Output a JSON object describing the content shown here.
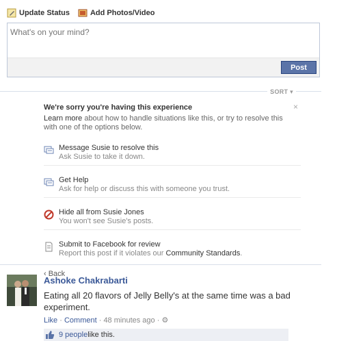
{
  "composer": {
    "tabs": [
      {
        "label": "Update Status",
        "icon": "status-pencil-icon"
      },
      {
        "label": "Add Photos/Video",
        "icon": "photo-icon"
      }
    ],
    "placeholder": "What's on your mind?",
    "post_label": "Post"
  },
  "feed": {
    "sort_label": "SORT"
  },
  "feedback": {
    "title": "We're sorry you're having this experience",
    "close_glyph": "×",
    "desc_link": "Learn more",
    "desc_text": " about how to handle situations like this, or try to resolve this with one of the options below.",
    "options": [
      {
        "label": "Message Susie to resolve this",
        "sub": "Ask Susie to take it down.",
        "icon": "message-icon"
      },
      {
        "label": "Get Help",
        "sub": "Ask for help or discuss this with someone you trust.",
        "icon": "help-chat-icon"
      },
      {
        "label": "Hide all from Susie Jones",
        "sub": "You won't see Susie's posts.",
        "icon": "block-icon"
      },
      {
        "label": "Submit to Facebook for review",
        "sub": "Report this post if it violates our ",
        "sub_link": "Community Standards",
        "sub_end": ".",
        "icon": "report-document-icon"
      }
    ],
    "back_label": "‹ Back"
  },
  "story": {
    "author": "Ashoke Chakrabarti",
    "message": "Eating all 20 flavors of Jelly Belly's at the same time was a bad experiment.",
    "like_label": "Like",
    "separator": " · ",
    "comment_label": "Comment",
    "timestamp": "48 minutes ago",
    "likes_link": "9 people",
    "likes_text": " like this."
  },
  "colors": {
    "link": "#3b5998",
    "post_button": "#5b74a8",
    "likes_bg": "#edeff4"
  }
}
